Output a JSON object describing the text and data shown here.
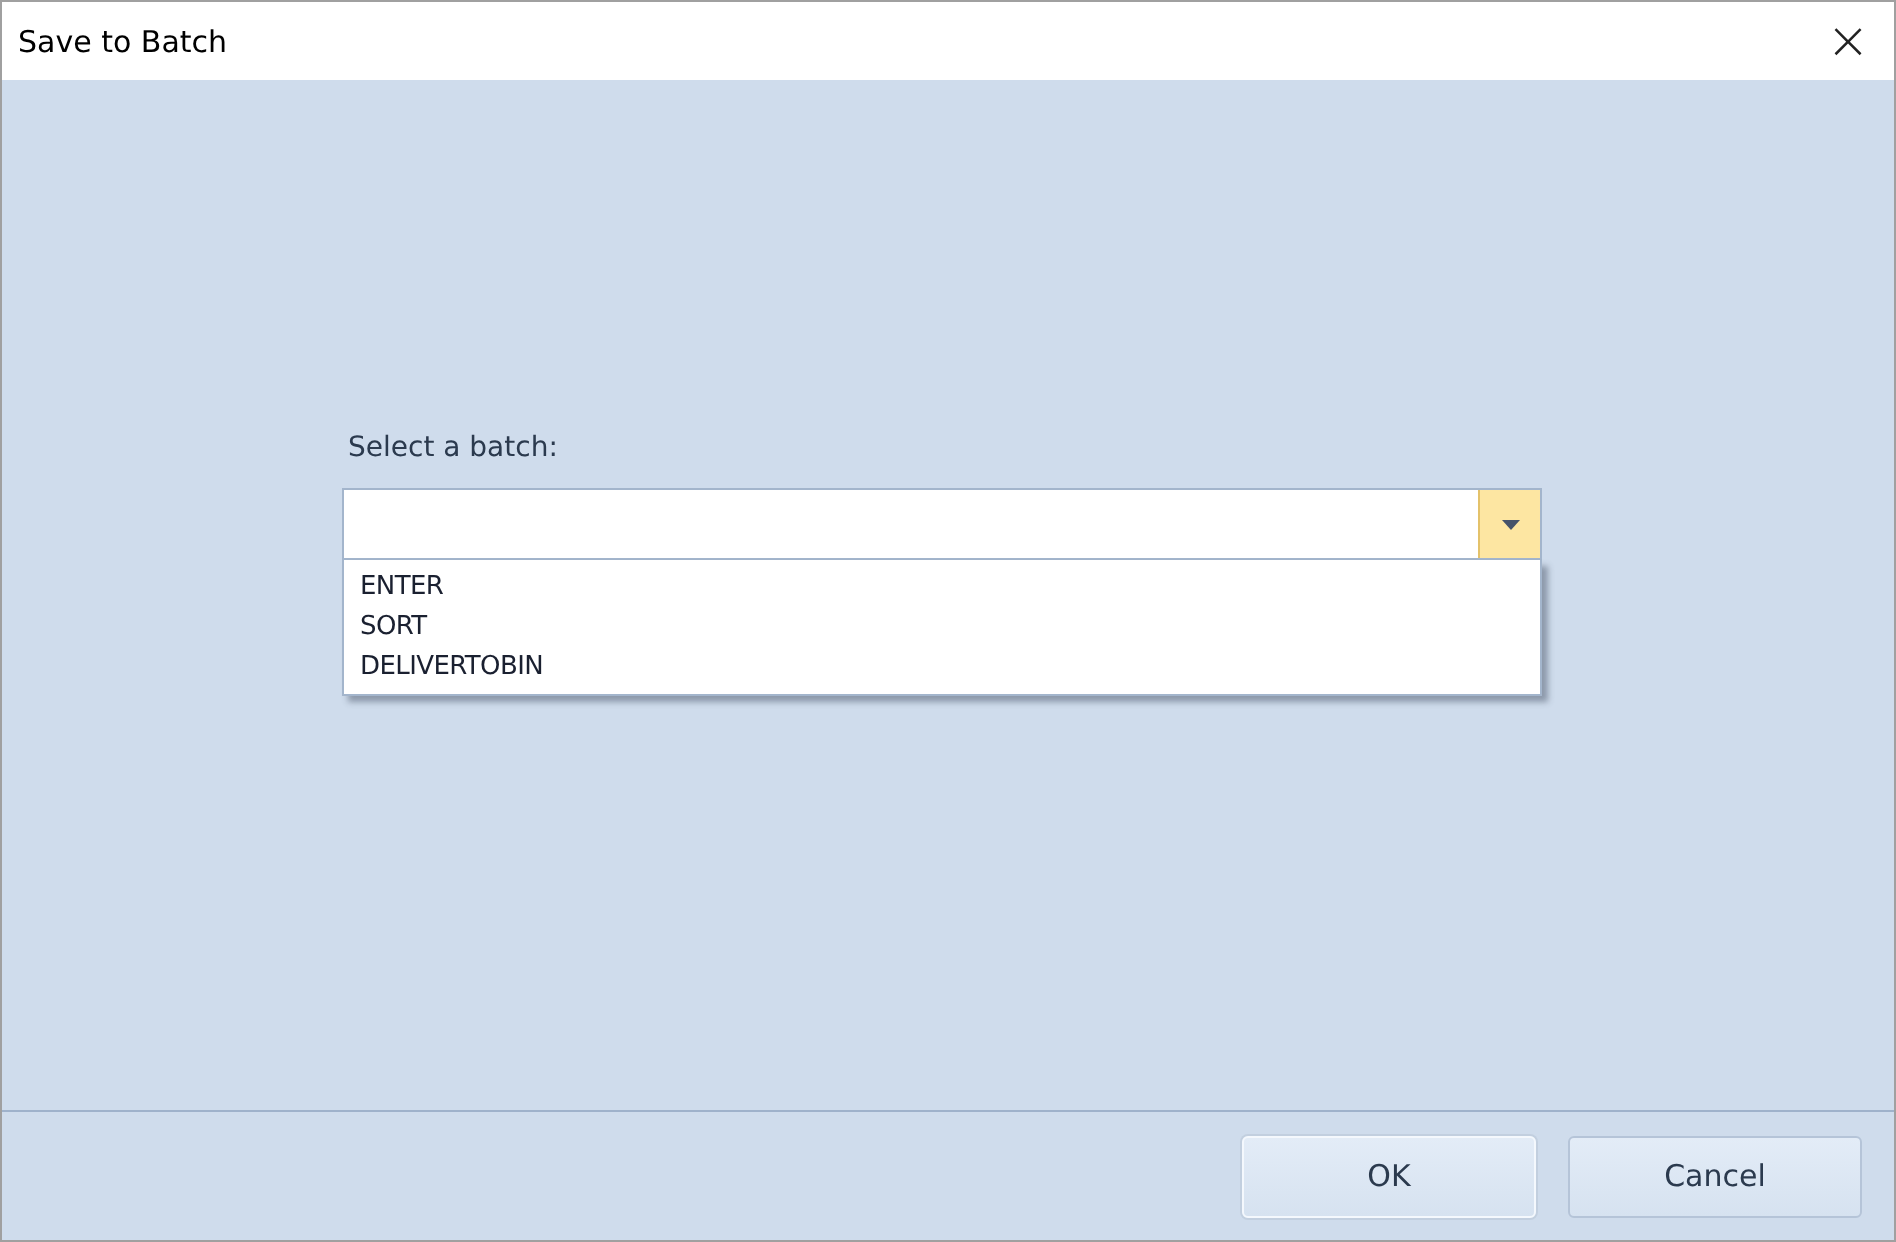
{
  "window": {
    "title": "Save to Batch",
    "close": "×"
  },
  "batch_field": {
    "label": "Select a batch:",
    "expanded": true,
    "options": [
      {
        "label": "ENTER"
      },
      {
        "label": "SORT"
      },
      {
        "label": "DELIVERTOBIN"
      }
    ]
  },
  "buttons": [
    {
      "label": "OK",
      "kind": "default"
    },
    {
      "label": "Cancel",
      "kind": "normal"
    }
  ]
}
